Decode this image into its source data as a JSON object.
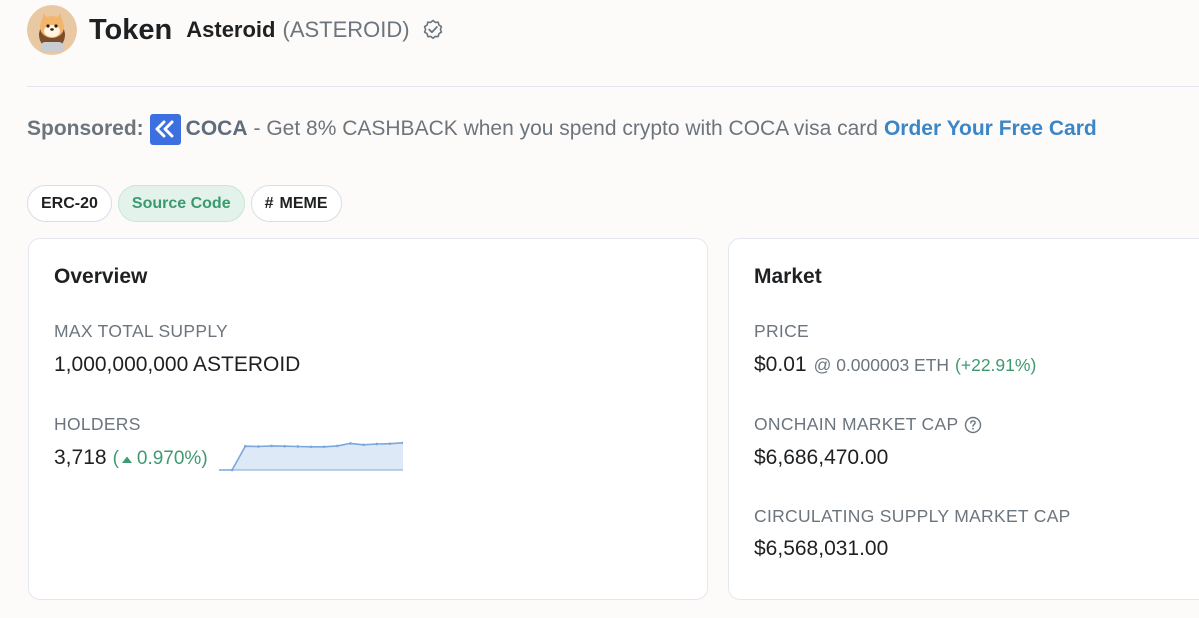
{
  "header": {
    "title": "Token",
    "token_name": "Asteroid",
    "token_symbol": "(ASTEROID)"
  },
  "sponsored": {
    "label": "Sponsored:",
    "brand": "COCA",
    "text": "- Get 8% CASHBACK when you spend crypto with COCA visa card",
    "link": "Order Your Free Card"
  },
  "badges": [
    {
      "label": "ERC-20"
    },
    {
      "label": "Source Code"
    },
    {
      "label": "MEME",
      "icon": "hash-icon"
    }
  ],
  "overview": {
    "title": "Overview",
    "max_supply_label": "MAX TOTAL SUPPLY",
    "max_supply_value": "1,000,000,000 ASTEROID",
    "holders_label": "HOLDERS",
    "holders_value": "3,718",
    "holders_change_open": "(",
    "holders_change": "0.970%)",
    "holders_trend": [
      0.0,
      0.0,
      0.85,
      0.84,
      0.86,
      0.85,
      0.84,
      0.83,
      0.83,
      0.86,
      0.95,
      0.9,
      0.93,
      0.94,
      0.97
    ]
  },
  "market": {
    "title": "Market",
    "price_label": "PRICE",
    "price_value": "$0.01",
    "price_eth": "@ 0.000003 ETH",
    "price_change": "(+22.91%)",
    "onchain_cap_label": "ONCHAIN MARKET CAP",
    "onchain_cap_value": "$6,686,470.00",
    "circ_cap_label": "CIRCULATING SUPPLY MARKET CAP",
    "circ_cap_value": "$6,568,031.00"
  },
  "colors": {
    "accent_green": "#3f9a72",
    "link_blue": "#3b86c6",
    "sparkline_stroke": "#7aa7dc",
    "sparkline_fill": "#dde9f7"
  }
}
